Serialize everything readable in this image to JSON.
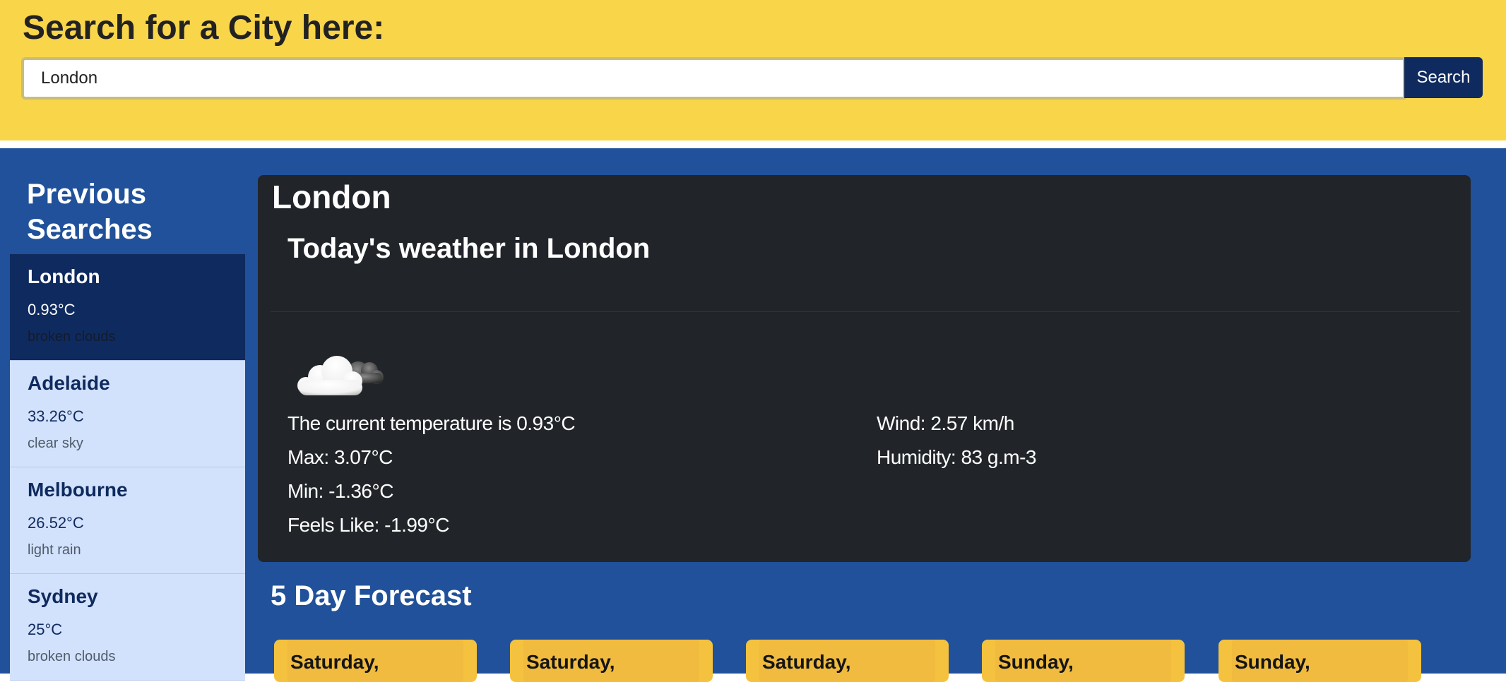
{
  "search": {
    "heading": "Search for a City here:",
    "value": "London",
    "button_label": "Search"
  },
  "sidebar": {
    "title_line1": "Previous",
    "title_line2": "Searches",
    "items": [
      {
        "city": "London",
        "temp": "0.93°C",
        "description": "broken clouds",
        "active": true
      },
      {
        "city": "Adelaide",
        "temp": "33.26°C",
        "description": "clear sky",
        "active": false
      },
      {
        "city": "Melbourne",
        "temp": "26.52°C",
        "description": "light rain",
        "active": false
      },
      {
        "city": "Sydney",
        "temp": "25°C",
        "description": "broken clouds",
        "active": false
      }
    ]
  },
  "current": {
    "city": "London",
    "subtitle": "Today's weather in London",
    "icon": "broken-clouds-icon",
    "current_temp": "The current temperature is 0.93°C",
    "max": "Max: 3.07°C",
    "min": "Min: -1.36°C",
    "feels_like": "Feels Like: -1.99°C",
    "wind": "Wind: 2.57 km/h",
    "humidity": "Humidity: 83 g.m-3"
  },
  "forecast": {
    "title": "5 Day Forecast",
    "days": [
      {
        "label": "Saturday,"
      },
      {
        "label": "Saturday,"
      },
      {
        "label": "Saturday,"
      },
      {
        "label": "Sunday,"
      },
      {
        "label": "Sunday,"
      }
    ]
  },
  "colors": {
    "header_bg": "#f9d54a",
    "main_bg": "#20519a",
    "active_item_bg": "#0f2a5e",
    "inactive_item_bg": "#d3e2fc",
    "card_bg": "#212529",
    "forecast_card_bg": "#f4c23e"
  }
}
